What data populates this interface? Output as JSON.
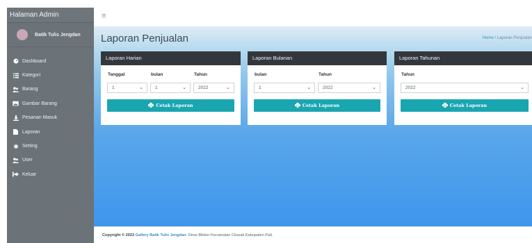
{
  "sidebar": {
    "brand": "Halaman Admin",
    "user_name": "Batik Tulis Jengdan",
    "items": [
      {
        "label": "Dashboard",
        "icon": "dashboard-icon"
      },
      {
        "label": "Kategori",
        "icon": "list-icon"
      },
      {
        "label": "Barang",
        "icon": "users-icon"
      },
      {
        "label": "Gambar Barang",
        "icon": "image-icon"
      },
      {
        "label": "Pesanan Masuk",
        "icon": "download-icon"
      },
      {
        "label": "Laporan",
        "icon": "file-icon"
      },
      {
        "label": "Setting",
        "icon": "gear-icon"
      },
      {
        "label": "User",
        "icon": "users-icon"
      },
      {
        "label": "Keluar",
        "icon": "signout-icon"
      }
    ]
  },
  "navbar": {
    "menu_icon": "hamburger-icon"
  },
  "header": {
    "title": "Laporan Penjualan",
    "breadcrumb_home": "Home",
    "breadcrumb_sep": "/",
    "breadcrumb_current": "Laporan Penjualan"
  },
  "cards": {
    "harian": {
      "title": "Laporan Harian",
      "label_tanggal": "Tanggal",
      "label_bulan": "bulan",
      "label_tahun": "Tahun",
      "tanggal": "1",
      "bulan": "1",
      "tahun": "2022",
      "button": "Cetak Laporan"
    },
    "bulanan": {
      "title": "Laporan Bulanan",
      "label_bulan": "bulan",
      "label_tahun": "Tahun",
      "bulan": "1",
      "tahun": "2022",
      "button": "Cetak Laporan"
    },
    "tahunan": {
      "title": "Laporan Tahunan",
      "label_tahun": "Tahun",
      "tahun": "2022",
      "button": "Cetak Laporan"
    }
  },
  "footer": {
    "prefix": "Copyright © 2023",
    "link": "Gallery Batik Tulis Jengdan",
    "suffix": ". Desa Bleber Kecamatan Cluwak Kabupaten Pati."
  },
  "colors": {
    "sidebar": "#6b7378",
    "card_header": "#33373b",
    "button": "#1aa6b1",
    "gradient_bottom": "#3e96ec"
  }
}
